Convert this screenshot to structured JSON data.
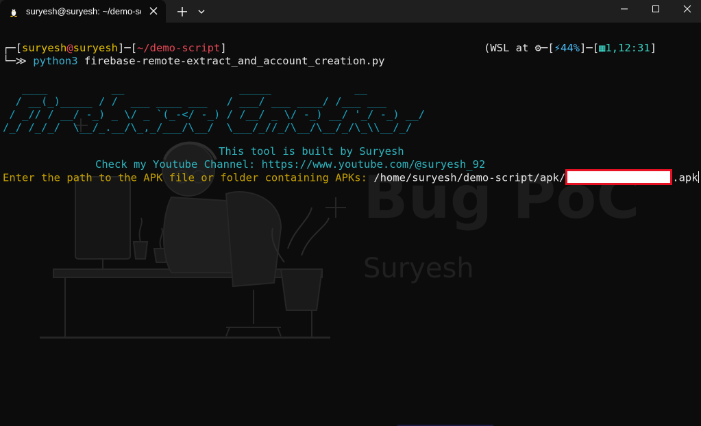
{
  "window": {
    "tab_title": "suryesh@suryesh: ~/demo-scr",
    "tab_icon": "linux-penguin-icon"
  },
  "prompt": {
    "corner_top": "┌─[",
    "user": "suryesh",
    "at": "@",
    "host": "suryesh",
    "sep": "]─[",
    "cwd": "~/demo-script",
    "close": "]",
    "corner_bottom": "└─",
    "arrow": "≫",
    "cmd_program": "python3",
    "cmd_args": "firebase-remote-extract_and_account_creation.py"
  },
  "status": {
    "prefix": "(WSL at ",
    "os_icon": "wsl-gear-icon",
    "open_bracket": "─[",
    "battery_icon": "battery-charging-icon",
    "battery": "44%",
    "mid": "]─[",
    "calendar_icon": "calendar-icon",
    "time": "1,12:31",
    "close": "]"
  },
  "banner": {
    "line1": "   ____          __                  _____             __ ",
    "line2": "  / __(_)_____ / /  ___ ____ ___   / ___/ ___ ____/ /___ ___ ",
    "line3": " / _// / __/ -_) _ \\/ _ `(_-</ -_) / /__/ _ \\/ -_) __/ '_/ -_) __/",
    "line4": "/_/ /_/_/  \\__/_.__/\\_,_/___/\\__/  \\___/_//_/\\__/\\__/_/\\_\\\\__/_/ "
  },
  "info": {
    "built_by": "This tool is built by Suryesh",
    "youtube": "Check my Youtube Channel: https://www.youtube.com/@suryesh_92",
    "enter_path_label": "Enter the path to the APK file or folder containing APKs:",
    "path_value": "/home/suryesh/demo-script/apk/",
    "path_suffix": ".apk"
  },
  "background": {
    "brand_title": "Bug PoC",
    "brand_name": "Suryesh"
  },
  "colors": {
    "terminal_bg": "#0c0c0c",
    "titlebar_bg": "#1f1f1f",
    "prompt_user": "#e5c100",
    "prompt_path": "#e74856",
    "ascii_banner": "#18a5c2",
    "info_text": "#2fb6c0",
    "prompt_label": "#c4a000",
    "redaction_border": "#e81123"
  }
}
